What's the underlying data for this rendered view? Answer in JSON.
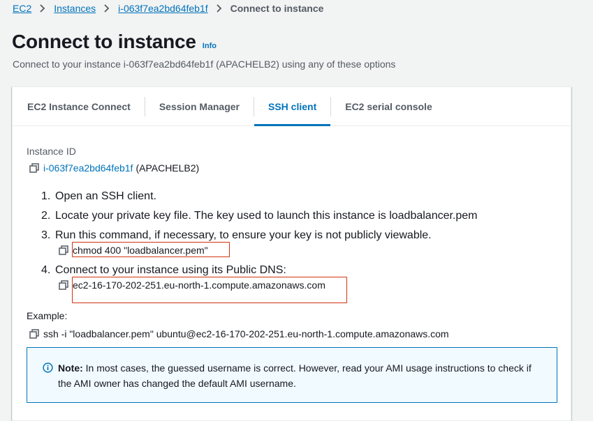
{
  "breadcrumb": {
    "items": [
      "EC2",
      "Instances",
      "i-063f7ea2bd64feb1f"
    ],
    "current": "Connect to instance"
  },
  "header": {
    "title": "Connect to instance",
    "info": "Info",
    "description": "Connect to your instance i-063f7ea2bd64feb1f (APACHELB2) using any of these options"
  },
  "tabs": [
    {
      "label": "EC2 Instance Connect",
      "active": false
    },
    {
      "label": "Session Manager",
      "active": false
    },
    {
      "label": "SSH client",
      "active": true
    },
    {
      "label": "EC2 serial console",
      "active": false
    }
  ],
  "instance": {
    "label": "Instance ID",
    "id": "i-063f7ea2bd64feb1f",
    "name": "(APACHELB2)"
  },
  "steps": [
    {
      "num": "1.",
      "text": "Open an SSH client."
    },
    {
      "num": "2.",
      "text": "Locate your private key file. The key used to launch this instance is loadbalancer.pem"
    },
    {
      "num": "3.",
      "text": "Run this command, if necessary, to ensure your key is not publicly viewable."
    },
    {
      "num": "4.",
      "text": "Connect to your instance using its Public DNS:"
    }
  ],
  "commands": {
    "chmod": "chmod 400 \"loadbalancer.pem\"",
    "dns": "ec2-16-170-202-251.eu-north-1.compute.amazonaws.com"
  },
  "example": {
    "label": "Example:",
    "command": "ssh -i \"loadbalancer.pem\" ubuntu@ec2-16-170-202-251.eu-north-1.compute.amazonaws.com"
  },
  "note": {
    "title": "Note:",
    "text": " In most cases, the guessed username is correct. However, read your AMI usage instructions to check if the AMI owner has changed the default AMI username."
  },
  "icons": {
    "copy": "copy-icon",
    "info": "info-circle-icon",
    "breadcrumb_separator": "chevron-right-icon"
  },
  "colors": {
    "link": "#0073bb",
    "highlight_box": "#d13212",
    "note_bg": "#f1faff"
  }
}
